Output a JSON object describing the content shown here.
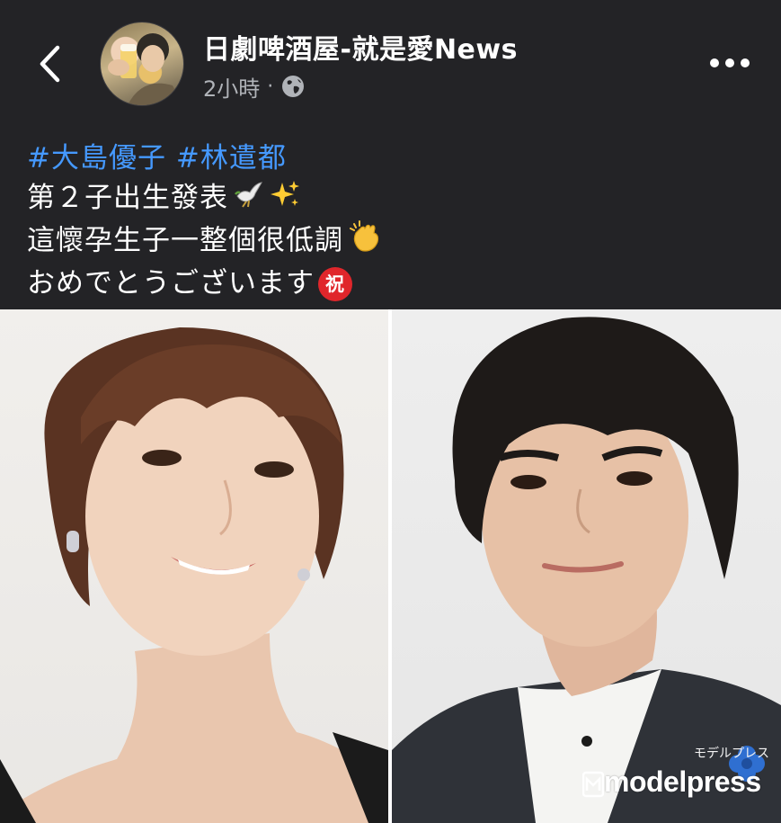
{
  "header": {
    "page_name": "日劇啤酒屋-就是愛News",
    "time": "2小時",
    "separator": "·",
    "privacy_icon": "globe-icon",
    "back_icon": "chevron-left-icon",
    "more_icon": "more-horizontal-icon"
  },
  "post": {
    "hashtags": [
      "#大島優子",
      "#林遣都"
    ],
    "lines": [
      "第２子出生發表",
      "這懷孕生子一整個很低調",
      "おめでとうございます"
    ],
    "emoji": {
      "line1": [
        "dove-emoji",
        "sparkles-emoji"
      ],
      "line2": "clapping-hands-emoji",
      "line3_badge": "祝"
    }
  },
  "photo": {
    "left_subject": "woman-smiling",
    "right_subject": "man-in-suit",
    "watermark_small": "モデルプレス",
    "watermark_main": "modelpress"
  },
  "colors": {
    "background": "#232326",
    "hashtag": "#4599ff",
    "meta_text": "#b0b3b8",
    "badge": "#e0262b"
  }
}
